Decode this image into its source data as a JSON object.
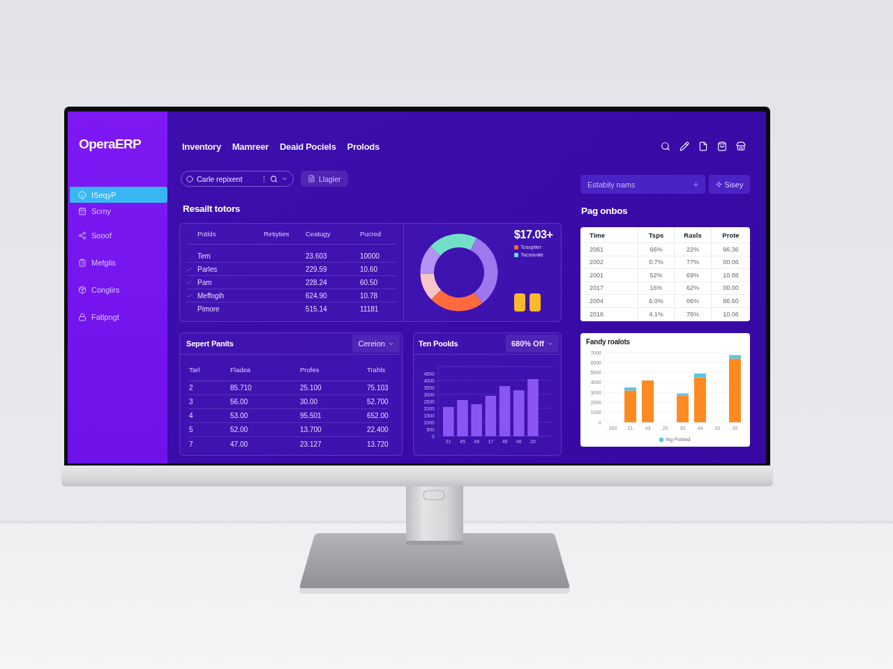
{
  "sidebar": {
    "logo": "OperaERP",
    "items": [
      {
        "label": "ISeqyP",
        "selected": true
      },
      {
        "label": "Scrny",
        "selected": false
      },
      {
        "label": "Sooof",
        "selected": false
      },
      {
        "label": "Mefglis",
        "selected": false
      },
      {
        "label": "Conglirs",
        "selected": false
      },
      {
        "label": "Fatlpngt",
        "selected": false
      }
    ]
  },
  "top_nav": {
    "links": [
      "Inventory",
      "Mamreer",
      "Deaid Pociels",
      "Prolods"
    ]
  },
  "toolbar": {
    "search": {
      "placeholder": "Carle repixent"
    },
    "button": "Llagier"
  },
  "side_toolbar": {
    "input": {
      "placeholder": "Estabily nams"
    },
    "button": "Sisey"
  },
  "results": {
    "title": "Resailt totors",
    "columns": [
      "Potlds",
      "Retiyties",
      "Ceatugy",
      "Pucred"
    ],
    "rows": [
      {
        "label": "Tem",
        "checked": false,
        "values": [
          "23.603",
          "10000"
        ]
      },
      {
        "label": "Parles",
        "checked": true,
        "values": [
          "229.59",
          "10.60"
        ]
      },
      {
        "label": "Pam",
        "checked": true,
        "values": [
          "228.24",
          "60.50"
        ]
      },
      {
        "label": "Meffogih",
        "checked": true,
        "values": [
          "624.90",
          "10.78"
        ]
      },
      {
        "label": "Pimore",
        "checked": false,
        "values": [
          "515.14",
          "11181"
        ]
      }
    ],
    "summary": {
      "value": "$17.03+",
      "legend": [
        {
          "label": "Tosuplier",
          "color": "#ff6a3d"
        },
        {
          "label": "Tacssvale",
          "color": "#6ad8e6"
        }
      ]
    }
  },
  "report": {
    "title": "Sepert Panits",
    "dropdown": "Cereion",
    "columns": [
      "Tarl",
      "Fladea",
      "Profes",
      "Trahls"
    ],
    "rows": [
      [
        "2",
        "85.710",
        "25.100",
        "75.103"
      ],
      [
        "3",
        "56.00",
        "30.00",
        "52.700"
      ],
      [
        "4",
        "53.00",
        "95.501",
        "652.00"
      ],
      [
        "5",
        "52.00",
        "13.700",
        "22.400"
      ],
      [
        "7",
        "47.00",
        "23.127",
        "13.720"
      ]
    ]
  },
  "top_products": {
    "title": "Ten Poolds",
    "dropdown": "680% Off",
    "chart_data": {
      "type": "bar",
      "categories": [
        "21",
        "45",
        "45",
        "17",
        "45",
        "46",
        "20"
      ],
      "series": [
        {
          "color": "#8a56f3",
          "values": [
            2100,
            2600,
            2300,
            2900,
            3600,
            3300,
            4100
          ]
        }
      ],
      "ylim": [
        0,
        5000
      ],
      "yticks": [
        0,
        500,
        1000,
        1500,
        2000,
        2500,
        3000,
        3500,
        4000,
        4500
      ],
      "grid": true
    }
  },
  "pay_options": {
    "title": "Pag onbos",
    "columns": [
      "Time",
      "Tsps",
      "Rasls",
      "Prote"
    ],
    "rows": [
      [
        "2061",
        "66%",
        "22%",
        "96.36"
      ],
      [
        "2002",
        "0.7%",
        "77%",
        "00.06"
      ],
      [
        "2001",
        "52%",
        "69%",
        "10.88"
      ],
      [
        "2017",
        "16%",
        "62%",
        "00.00"
      ],
      [
        "2004",
        "6.0%",
        "06%",
        "86.60"
      ],
      [
        "2016",
        "4.1%",
        "76%",
        "10.06"
      ]
    ]
  },
  "trend": {
    "title": "Fandy roalots",
    "chart_data": {
      "type": "bar",
      "stacked": true,
      "categories": [
        "200",
        "21",
        "43",
        "20",
        "30",
        "44",
        "20",
        "20"
      ],
      "series": [
        {
          "color": "#ff8a22",
          "values": [
            0,
            3200,
            4200,
            0,
            2700,
            4500,
            0,
            6400
          ]
        },
        {
          "name": "Ng Posted",
          "color": "#5cc6e2",
          "values": [
            0,
            300,
            0,
            0,
            200,
            400,
            0,
            350
          ]
        }
      ],
      "ylim": [
        0,
        7000
      ],
      "yticks": [
        0,
        1000,
        2000,
        3000,
        4000,
        5000,
        6000,
        7000
      ],
      "grid": true
    }
  }
}
